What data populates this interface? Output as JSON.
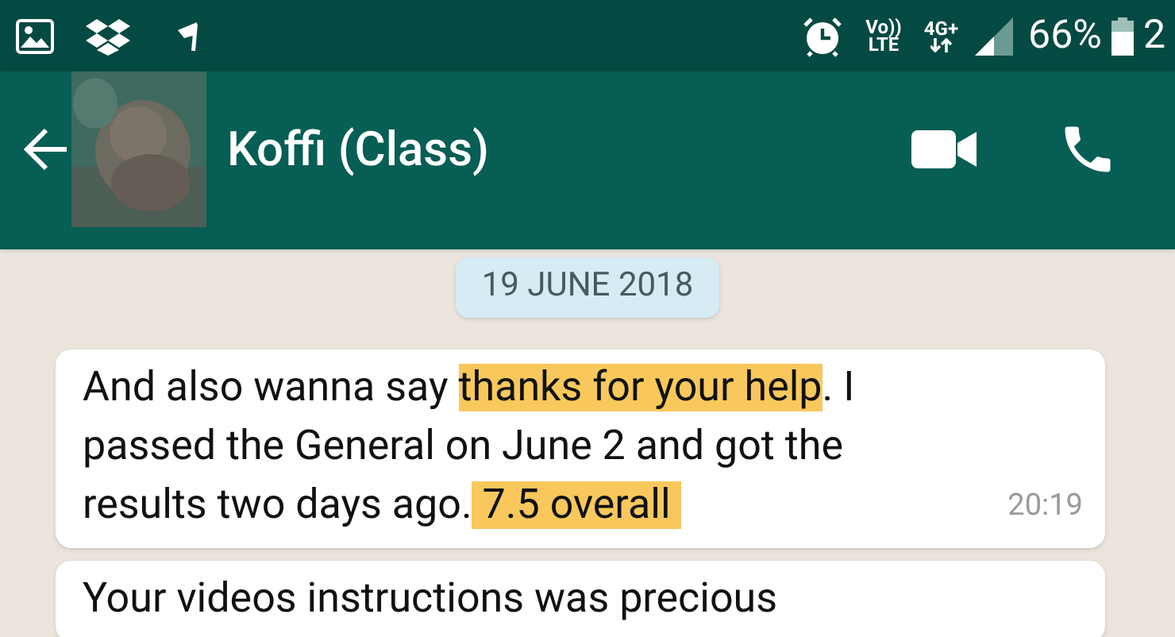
{
  "status_bar": {
    "volte": [
      "Vo))",
      "LTE"
    ],
    "network": "4G+",
    "battery": "66%",
    "clock": "2"
  },
  "header": {
    "title": "Koffi (Class)"
  },
  "date_chip": "19 JUNE 2018",
  "messages": [
    {
      "time": "20:19",
      "lines": [
        [
          {
            "text": "And also wanna say ",
            "highlighted": false
          },
          {
            "text": "thanks for your help",
            "highlighted": true
          },
          {
            "text": ". I",
            "highlighted": false
          }
        ],
        [
          {
            "text": "passed the General on June 2 and got the",
            "highlighted": false
          }
        ],
        [
          {
            "text": "results two days ago.",
            "highlighted": false
          },
          {
            "text": " 7.5 overall ",
            "highlighted": true
          }
        ]
      ]
    },
    {
      "lines": [
        [
          {
            "text": "Your videos instructions was precious",
            "highlighted": false
          }
        ]
      ]
    }
  ]
}
